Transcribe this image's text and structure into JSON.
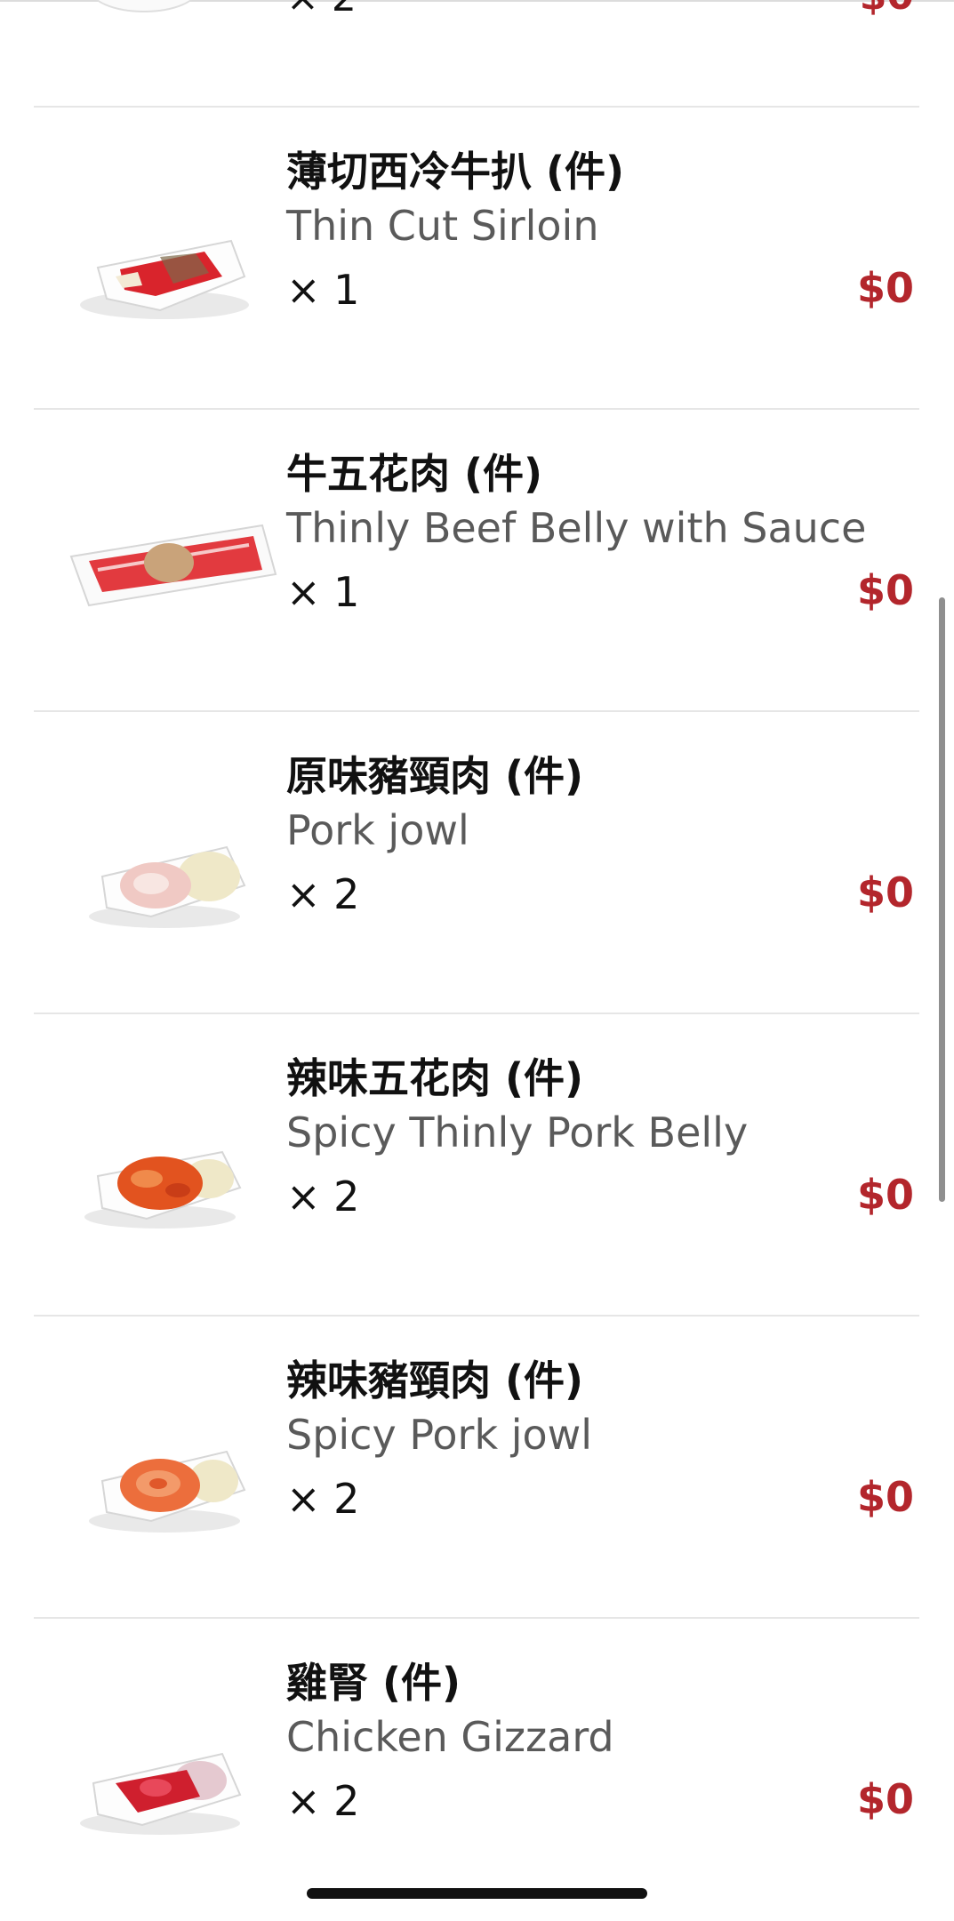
{
  "colors": {
    "price": "#b3262c",
    "primary_text": "#111111",
    "secondary_text": "#5a5a5a",
    "divider": "#e6e6e6"
  },
  "partial_item": {
    "qty": "× 2",
    "price": "$0"
  },
  "items": [
    {
      "name_zh": "薄切西冷牛扒 (件)",
      "name_en": "Thin Cut Sirloin",
      "qty": "× 1",
      "price": "$0",
      "icon": "sirloin-dish-icon"
    },
    {
      "name_zh": "牛五花肉 (件)",
      "name_en": "Thinly Beef Belly with Sauce",
      "qty": "× 1",
      "price": "$0",
      "icon": "beef-belly-dish-icon"
    },
    {
      "name_zh": "原味豬頸肉 (件)",
      "name_en": "Pork jowl",
      "qty": "× 2",
      "price": "$0",
      "icon": "pork-jowl-dish-icon"
    },
    {
      "name_zh": "辣味五花肉 (件)",
      "name_en": "Spicy Thinly Pork Belly",
      "qty": "× 2",
      "price": "$0",
      "icon": "spicy-pork-belly-dish-icon"
    },
    {
      "name_zh": "辣味豬頸肉 (件)",
      "name_en": "Spicy Pork jowl",
      "qty": "× 2",
      "price": "$0",
      "icon": "spicy-pork-jowl-dish-icon"
    },
    {
      "name_zh": "雞腎 (件)",
      "name_en": "Chicken Gizzard",
      "qty": "× 2",
      "price": "$0",
      "icon": "chicken-gizzard-dish-icon"
    }
  ]
}
